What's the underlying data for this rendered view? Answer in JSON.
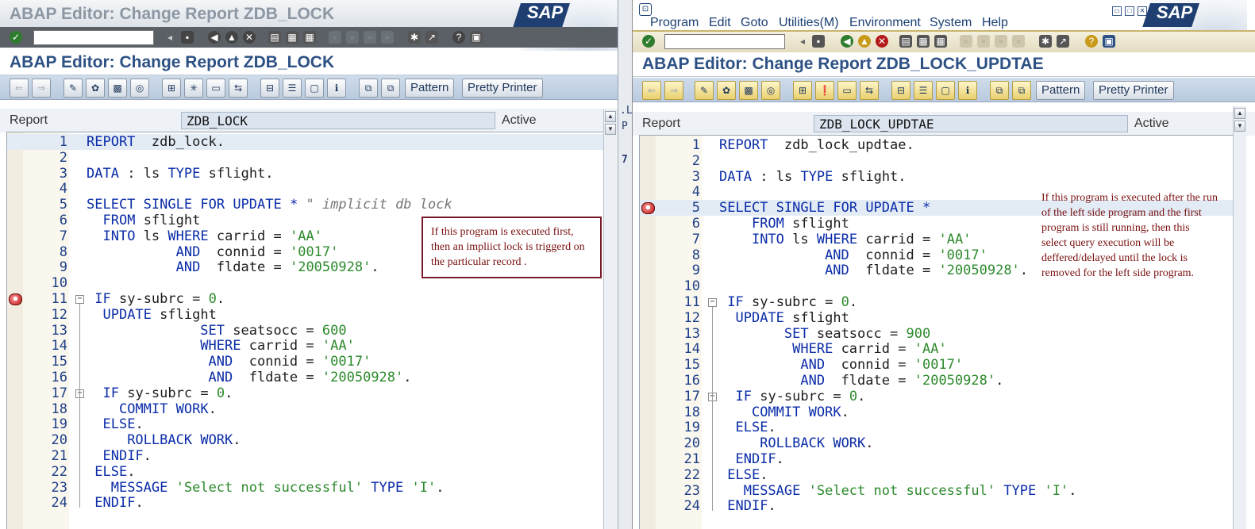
{
  "left": {
    "window_title": "ABAP Editor: Change Report ZDB_LOCK",
    "logo": "SAP",
    "screen_title": "ABAP Editor: Change Report ZDB_LOCK",
    "toolbar": {
      "pattern_label": "Pattern",
      "pretty_printer_label": "Pretty Printer"
    },
    "header": {
      "report_label": "Report",
      "report_value": "ZDB_LOCK",
      "status": "Active"
    },
    "annotation": "If this program is executed first, then an impliict lock is triggerd on the particular record .",
    "lines": [
      {
        "n": "1",
        "t": "REPORT  zdb_lock."
      },
      {
        "n": "2",
        "t": ""
      },
      {
        "n": "3",
        "t": "DATA : ls TYPE sflight."
      },
      {
        "n": "4",
        "t": ""
      },
      {
        "n": "5",
        "t": "SELECT SINGLE FOR UPDATE * \" implicit db lock"
      },
      {
        "n": "6",
        "t": "  FROM sflight"
      },
      {
        "n": "7",
        "t": "  INTO ls WHERE carrid = 'AA'"
      },
      {
        "n": "8",
        "t": "           AND  connid = '0017'"
      },
      {
        "n": "9",
        "t": "           AND  fldate = '20050928'."
      },
      {
        "n": "10",
        "t": ""
      },
      {
        "n": "11",
        "t": " IF sy-subrc = 0."
      },
      {
        "n": "12",
        "t": "  UPDATE sflight"
      },
      {
        "n": "13",
        "t": "              SET seatsocc = 600"
      },
      {
        "n": "14",
        "t": "              WHERE carrid = 'AA'"
      },
      {
        "n": "15",
        "t": "               AND  connid = '0017'"
      },
      {
        "n": "16",
        "t": "               AND  fldate = '20050928'."
      },
      {
        "n": "17",
        "t": "  IF sy-subrc = 0."
      },
      {
        "n": "18",
        "t": "    COMMIT WORK."
      },
      {
        "n": "19",
        "t": "  ELSE."
      },
      {
        "n": "20",
        "t": "     ROLLBACK WORK."
      },
      {
        "n": "21",
        "t": "  ENDIF."
      },
      {
        "n": "22",
        "t": " ELSE."
      },
      {
        "n": "23",
        "t": "   MESSAGE 'Select not successful' TYPE 'I'."
      },
      {
        "n": "24",
        "t": " ENDIF."
      }
    ]
  },
  "right": {
    "logo": "SAP",
    "menu": [
      "Program",
      "Edit",
      "Goto",
      "Utilities(M)",
      "Environment",
      "System",
      "Help"
    ],
    "screen_title": "ABAP Editor: Change Report ZDB_LOCK_UPDTAE",
    "toolbar": {
      "pattern_label": "Pattern",
      "pretty_printer_label": "Pretty Printer"
    },
    "header": {
      "report_label": "Report",
      "report_value": "ZDB_LOCK_UPDTAE",
      "status": "Active"
    },
    "annotation": "If this program is executed after the run of the left side program and the first program is still running, then this select query execution will be deffered/delayed until the lock is removed for the left side program.",
    "lines": [
      {
        "n": "1",
        "t": "REPORT  zdb_lock_updtae."
      },
      {
        "n": "2",
        "t": ""
      },
      {
        "n": "3",
        "t": "DATA : ls TYPE sflight."
      },
      {
        "n": "4",
        "t": ""
      },
      {
        "n": "5",
        "t": "SELECT SINGLE FOR UPDATE *"
      },
      {
        "n": "6",
        "t": "    FROM sflight"
      },
      {
        "n": "7",
        "t": "    INTO ls WHERE carrid = 'AA'"
      },
      {
        "n": "8",
        "t": "             AND  connid = '0017'"
      },
      {
        "n": "9",
        "t": "             AND  fldate = '20050928'."
      },
      {
        "n": "10",
        "t": ""
      },
      {
        "n": "11",
        "t": " IF sy-subrc = 0."
      },
      {
        "n": "12",
        "t": "  UPDATE sflight"
      },
      {
        "n": "13",
        "t": "        SET seatsocc = 900"
      },
      {
        "n": "14",
        "t": "         WHERE carrid = 'AA'"
      },
      {
        "n": "15",
        "t": "          AND  connid = '0017'"
      },
      {
        "n": "16",
        "t": "          AND  fldate = '20050928'."
      },
      {
        "n": "17",
        "t": "  IF sy-subrc = 0."
      },
      {
        "n": "18",
        "t": "    COMMIT WORK."
      },
      {
        "n": "19",
        "t": "  ELSE."
      },
      {
        "n": "20",
        "t": "     ROLLBACK WORK."
      },
      {
        "n": "21",
        "t": "  ENDIF."
      },
      {
        "n": "22",
        "t": " ELSE."
      },
      {
        "n": "23",
        "t": "   MESSAGE 'Select not successful' TYPE 'I'."
      },
      {
        "n": "24",
        "t": " ENDIF."
      }
    ]
  },
  "middle_fragments": [
    ".Li",
    "P",
    "7"
  ],
  "icons": [
    "enter-icon",
    "save-icon",
    "back-icon",
    "exit-icon",
    "cancel-icon",
    "print-icon",
    "find-icon",
    "find-next-icon",
    "help-icon",
    "breakpoint-icon",
    "stop-icon"
  ],
  "colors": {
    "keyword": "#0a2ca8",
    "string": "#2c8a2c",
    "comment": "#777777",
    "title": "#2d5184",
    "annotation": "#7a1010"
  }
}
